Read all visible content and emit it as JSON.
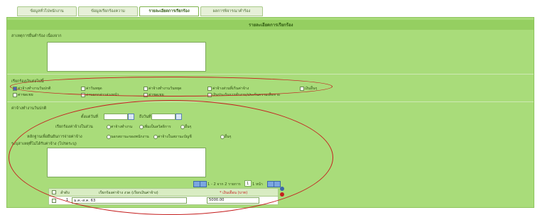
{
  "tabs": [
    {
      "label": "ข้อมูลทั่วไปพนักงาน"
    },
    {
      "label": "ข้อมูลเรียกร้องความ"
    },
    {
      "label": "รายละเอียดการเรียกร้อง"
    },
    {
      "label": "ผลการพิจารณาคำร้อง"
    }
  ],
  "panel": {
    "title": "รายละเอียดการเรียกร้อง",
    "reason_label": "สาเหตุการยื่นคำร้อง เนื่องจาก",
    "claim_group_label": "เรียกร้องเงินต่อไปนี้",
    "checkboxes": [
      {
        "label": "ค่าจ้างทำงานวันปกติ",
        "checked": true
      },
      {
        "label": "ค่าวันหยุด",
        "checked": false
      },
      {
        "label": "ค่าจ้างทำงานวันหยุด",
        "checked": false
      },
      {
        "label": "ค่าจ้างส่วนที่เกินค่าจ้าง",
        "checked": false
      },
      {
        "label": "เงินอื่นๆ",
        "checked": false
      },
      {
        "label": "ค่าชดเชย",
        "checked": false
      },
      {
        "label": "ค่าบอกกล่าวล่วงหน้า",
        "checked": false
      },
      {
        "label": "ค่าชดเชย",
        "checked": false
      },
      {
        "label": "เงินประกันการทำงาน/ประกันความเสียหาย",
        "checked": false
      }
    ],
    "section2_label": "ค่าจ้างทำงานวันปกติ",
    "from_label": "ตั้งแต่วันที่",
    "to_label": "ถึงวันที่",
    "pay_label": "เรียกร้องค่าจ้างในส่วน",
    "pay_options": [
      "ค่าจ้างทำงาน",
      "เพิ่มเป็นสวัสดิการ",
      "อื่นๆ"
    ],
    "reason2_label": "หลักฐานเพื่อยืนยันการจ่ายค่าจ้าง",
    "reason2_options": [
      "นอกสถานะของพนักงาน",
      "ค่าจ้างในสถานะบัญชี",
      "อื่นๆ"
    ],
    "detail_label": "ระบุสาเหตุที่ไม่ได้รับค่าจ้าง (โปรดระบุ)",
    "pager": {
      "text": "1 - 2 จาก 2 รายการ",
      "page": "1",
      "of": "1 หน้า"
    },
    "table": {
      "headers": [
        "ลำดับ",
        "เรียกร้องค่าจ้าง งวด (เรียกเงินค่าจ้าง)",
        "* เงินเดือน (บาท)"
      ],
      "rows": [
        {
          "no": "1",
          "period": "ม.ค.-ส.ค. 63",
          "amount": "5000.00"
        }
      ]
    }
  },
  "colors": {
    "panel": "#a9dc7a",
    "ring": "#c51f1f",
    "header": "#95cf61"
  }
}
